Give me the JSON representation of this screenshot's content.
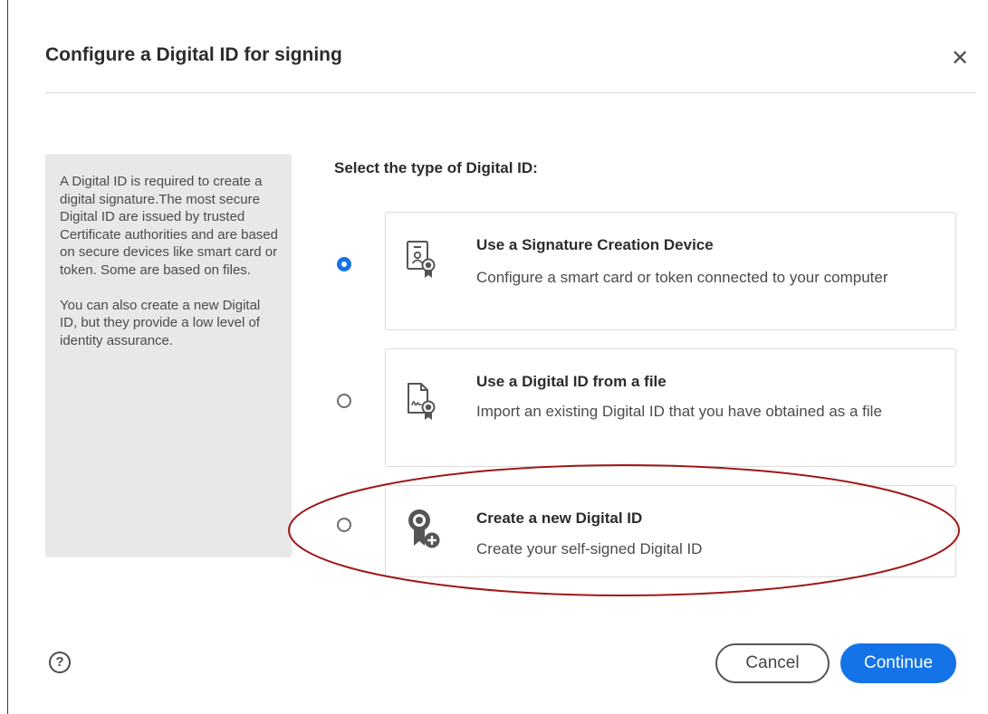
{
  "dialog": {
    "title": "Configure a Digital ID for signing",
    "close_icon": "close-icon"
  },
  "info_panel": {
    "paragraph1": "A Digital ID is required to create a digital signature.The most secure Digital ID are issued by trusted Certificate authorities and are based on secure devices like smart card or token. Some are based on files.",
    "paragraph2": "You can also create a new Digital ID, but they provide a low level of identity assurance."
  },
  "section_heading": "Select the type of Digital ID:",
  "options": [
    {
      "title": "Use a Signature Creation Device",
      "description": "Configure a smart card or token connected to your computer",
      "icon": "signature-device-icon",
      "selected": true
    },
    {
      "title": "Use a Digital ID from a file",
      "description": "Import an existing Digital ID that you have obtained as a file",
      "icon": "digital-id-file-icon",
      "selected": false
    },
    {
      "title": "Create a new Digital ID",
      "description": "Create your self-signed Digital ID",
      "icon": "create-digital-id-icon",
      "selected": false
    }
  ],
  "footer": {
    "help_label": "?",
    "cancel_label": "Cancel",
    "continue_label": "Continue"
  },
  "colors": {
    "accent": "#1473e6",
    "highlight_ellipse": "#a01818",
    "info_panel_bg": "#e8e8e8"
  }
}
